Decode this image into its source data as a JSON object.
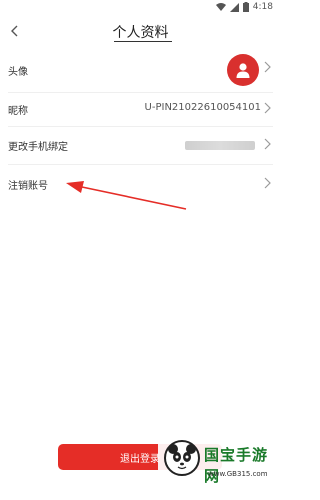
{
  "status_bar": {
    "time": "4:18",
    "icons": [
      "wifi-icon",
      "signal-icon",
      "battery-icon"
    ]
  },
  "header": {
    "back_icon": "chevron-left-icon",
    "title": "个人资料"
  },
  "rows": [
    {
      "label": "头像",
      "type": "avatar"
    },
    {
      "label": "昵称",
      "value": "U-PIN21022610054101"
    },
    {
      "label": "更改手机绑定",
      "value_blurred": true
    },
    {
      "label": "注销账号"
    }
  ],
  "logout_label": "退出登录",
  "watermark": {
    "brand": "国宝手游网",
    "url": "www.GB315.com"
  },
  "colors": {
    "accent": "#e52d27",
    "avatar_bg": "#d9302e"
  }
}
